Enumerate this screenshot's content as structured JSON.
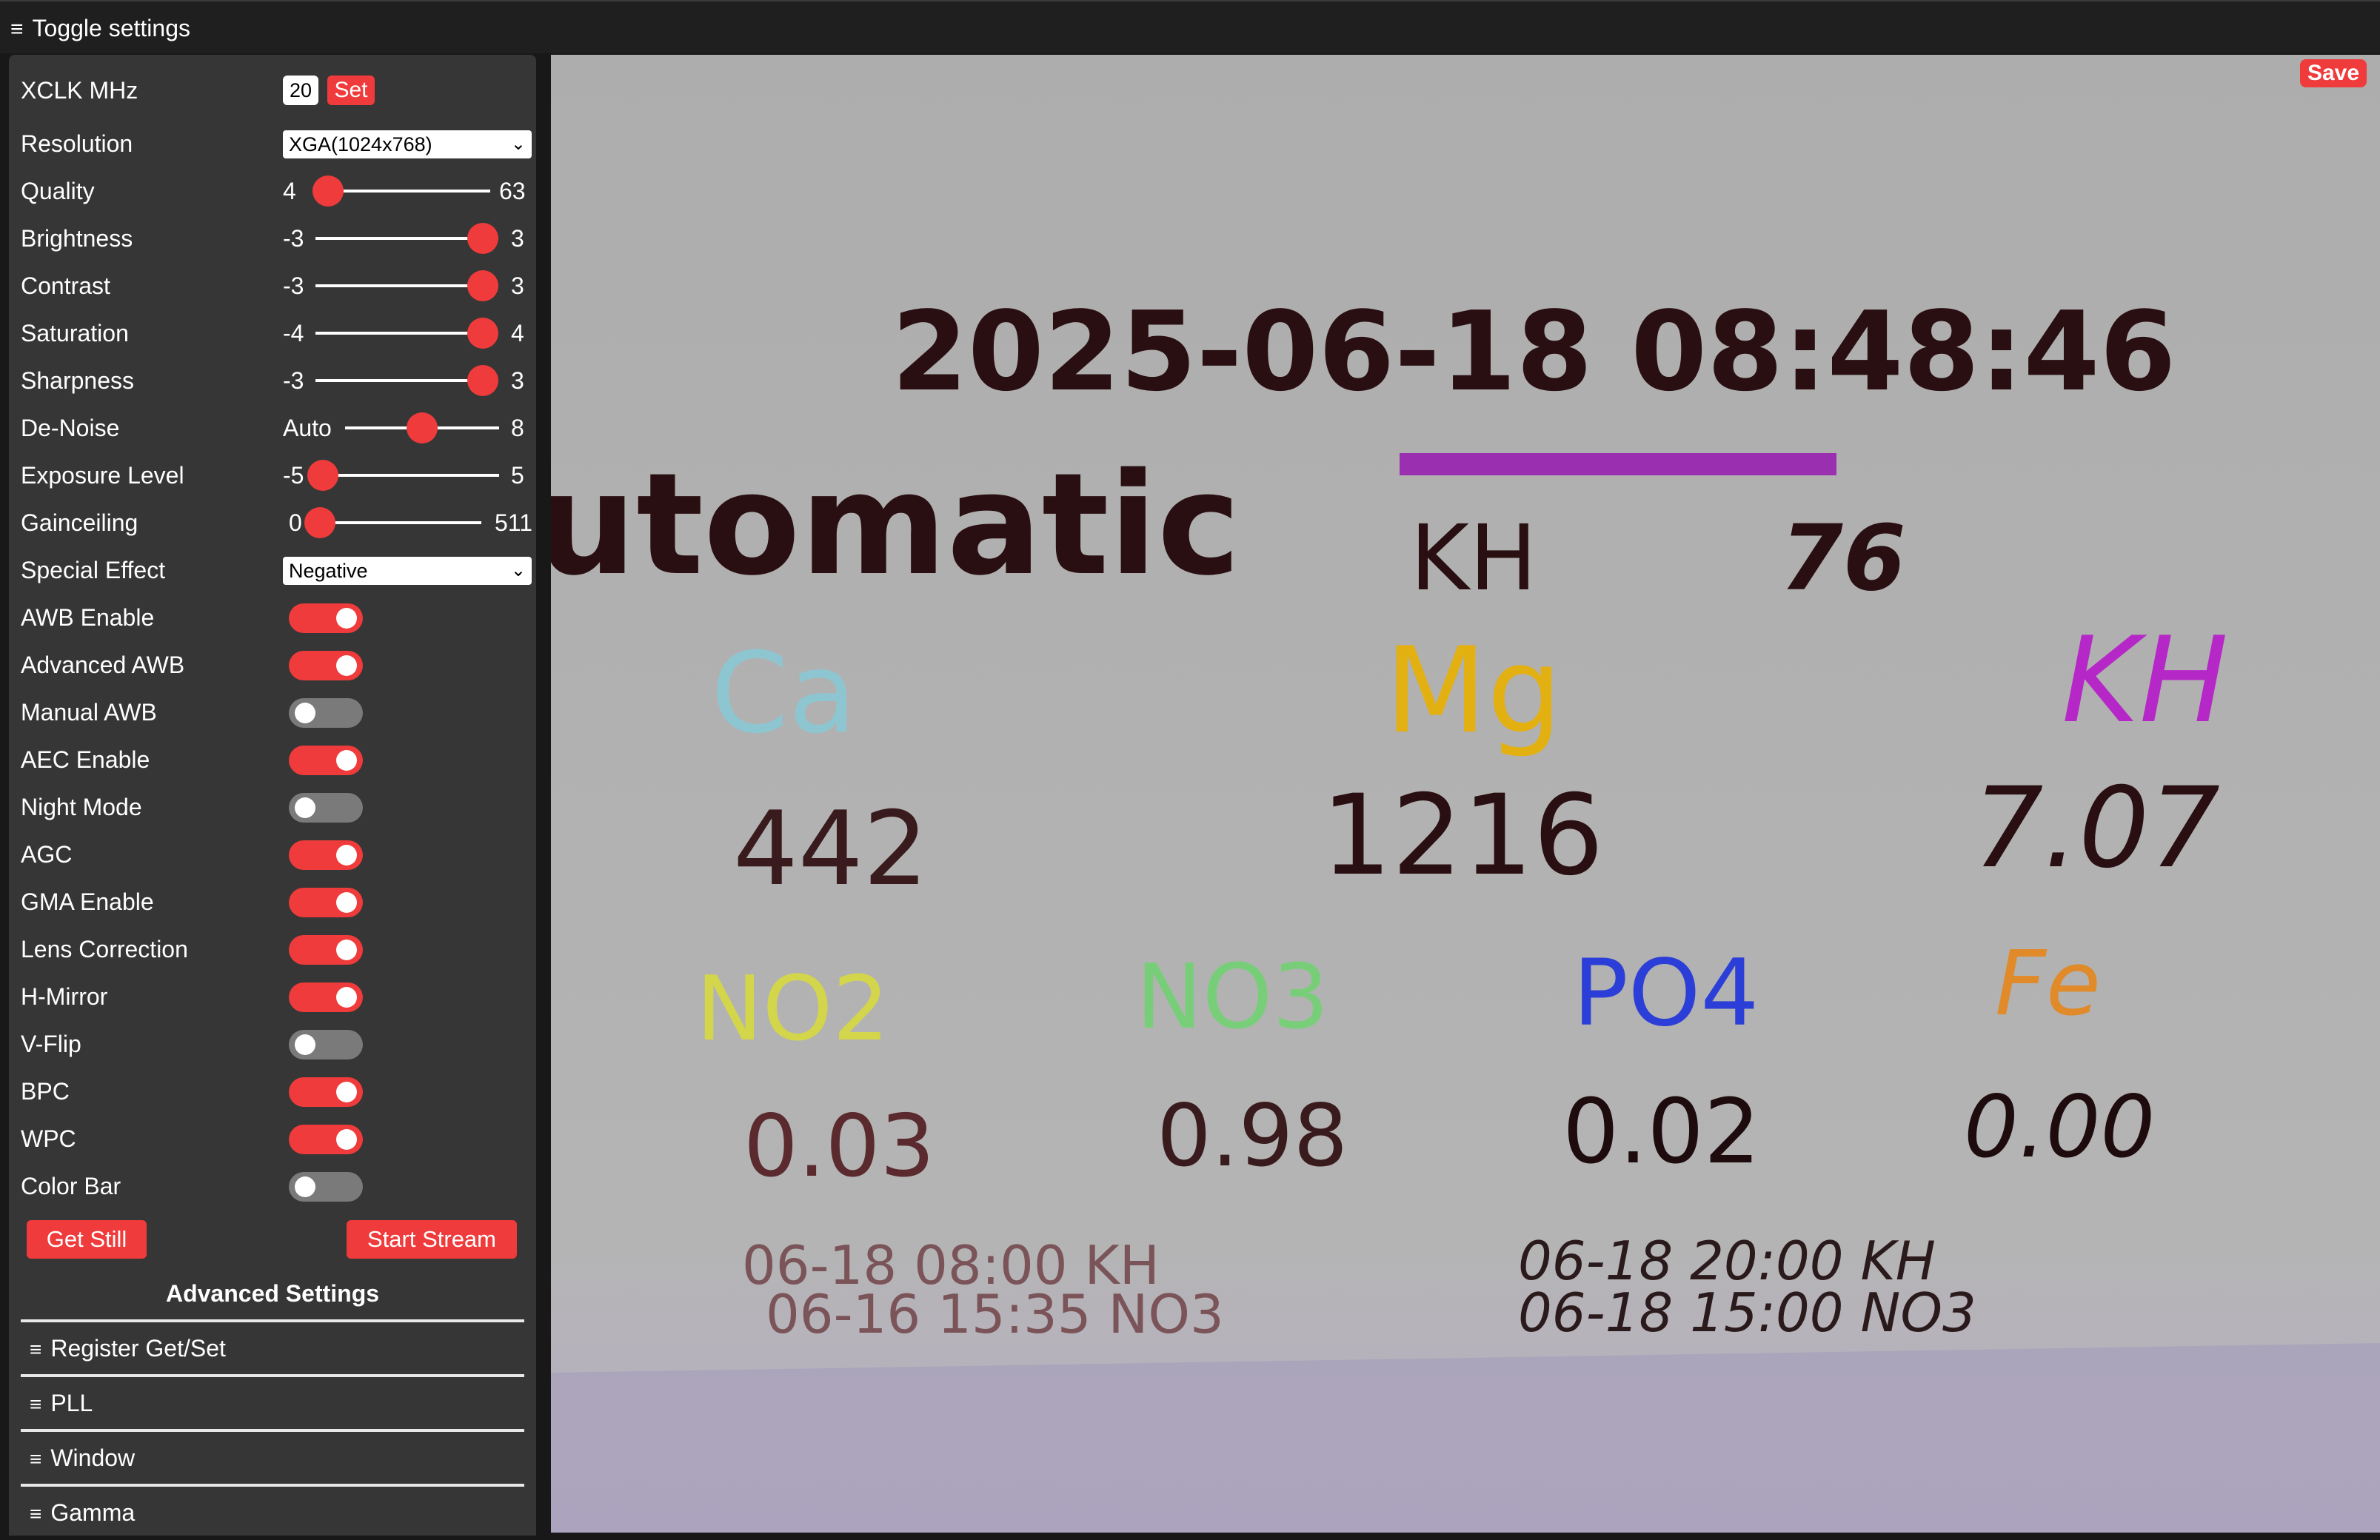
{
  "topbar": {
    "toggle_label": "Toggle settings"
  },
  "controls": {
    "xclk": {
      "label": "XCLK MHz",
      "value": "20",
      "button": "Set"
    },
    "resolution": {
      "label": "Resolution",
      "value": "XGA(1024x768)"
    },
    "sliders": [
      {
        "label": "Quality",
        "min": "4",
        "max": "63",
        "value": 6
      },
      {
        "label": "Brightness",
        "min": "-3",
        "max": "3",
        "value": 3
      },
      {
        "label": "Contrast",
        "min": "-3",
        "max": "3",
        "value": 3
      },
      {
        "label": "Saturation",
        "min": "-4",
        "max": "4",
        "value": 4
      },
      {
        "label": "Sharpness",
        "min": "-3",
        "max": "3",
        "value": 3
      },
      {
        "label": "De-Noise",
        "min": "Auto",
        "max": "8",
        "value": 4
      },
      {
        "label": "Exposure Level",
        "min": "-5",
        "max": "5",
        "value": -5
      },
      {
        "label": "Gainceiling",
        "min": "0",
        "max": "511",
        "value": 0
      }
    ],
    "special_effect": {
      "label": "Special Effect",
      "value": "Negative"
    },
    "toggles": [
      {
        "label": "AWB Enable",
        "on": true
      },
      {
        "label": "Advanced AWB",
        "on": true
      },
      {
        "label": "Manual AWB",
        "on": false
      },
      {
        "label": "AEC Enable",
        "on": true
      },
      {
        "label": "Night Mode",
        "on": false
      },
      {
        "label": "AGC",
        "on": true
      },
      {
        "label": "GMA Enable",
        "on": true
      },
      {
        "label": "Lens Correction",
        "on": true
      },
      {
        "label": "H-Mirror",
        "on": true
      },
      {
        "label": "V-Flip",
        "on": false
      },
      {
        "label": "BPC",
        "on": true
      },
      {
        "label": "WPC",
        "on": true
      },
      {
        "label": "Color Bar",
        "on": false
      }
    ],
    "get_still": "Get Still",
    "start_stream": "Start Stream"
  },
  "advanced": {
    "title": "Advanced Settings",
    "items": [
      "Register Get/Set",
      "PLL",
      "Window",
      "Gamma"
    ]
  },
  "preview": {
    "save_label": "Save",
    "datetime": "2025-06-18 08:48:46",
    "mode": "utomatic",
    "kh_label": "KH",
    "kh_value": "76",
    "kh_bar_color": "#9a2fb0",
    "params_row1": [
      {
        "name": "Ca",
        "value": "442",
        "color": "#7fd0df"
      },
      {
        "name": "Mg",
        "value": "1216",
        "color": "#e3b012"
      },
      {
        "name": "KH",
        "value": "7.07",
        "color": "#b527c6"
      }
    ],
    "params_row2": [
      {
        "name": "NO2",
        "value": "0.03",
        "color": "#d9dc3a"
      },
      {
        "name": "NO3",
        "value": "0.98",
        "color": "#6fd46f"
      },
      {
        "name": "PO4",
        "value": "0.02",
        "color": "#2b3fd8"
      },
      {
        "name": "Fe",
        "value": "0.00",
        "color": "#e08a2a"
      }
    ],
    "log_left": [
      "06-18 08:00 KH",
      "06-16 15:35 NO3"
    ],
    "log_right": [
      "06-18 20:00 KH",
      "06-18 15:00 NO3"
    ]
  },
  "colors": {
    "accent": "#ef3b3b",
    "panel": "#363636",
    "background": "#181818"
  }
}
